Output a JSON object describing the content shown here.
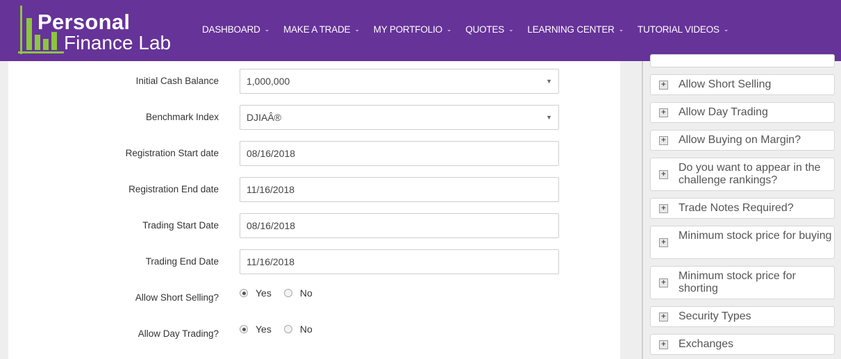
{
  "brand": {
    "line1": "Personal",
    "line2": "Finance Lab"
  },
  "nav": [
    {
      "label": "DASHBOARD"
    },
    {
      "label": "MAKE A TRADE"
    },
    {
      "label": "MY PORTFOLIO"
    },
    {
      "label": "QUOTES"
    },
    {
      "label": "LEARNING CENTER"
    },
    {
      "label": "TUTORIAL VIDEOS"
    }
  ],
  "form": {
    "initial_cash": {
      "label": "Initial Cash Balance",
      "value": "1,000,000"
    },
    "benchmark": {
      "label": "Benchmark Index",
      "value": "DJIAÂ®"
    },
    "reg_start": {
      "label": "Registration Start date",
      "value": "08/16/2018"
    },
    "reg_end": {
      "label": "Registration End date",
      "value": "11/16/2018"
    },
    "trade_start": {
      "label": "Trading Start Date",
      "value": "08/16/2018"
    },
    "trade_end": {
      "label": "Trading End Date",
      "value": "11/16/2018"
    },
    "short_selling": {
      "label": "Allow Short Selling?",
      "yes": "Yes",
      "no": "No",
      "selected": "Yes"
    },
    "day_trading": {
      "label": "Allow Day Trading?",
      "yes": "Yes",
      "no": "No",
      "selected": "Yes"
    }
  },
  "sidebar": {
    "items": [
      {
        "label": "Allow Short Selling"
      },
      {
        "label": "Allow Day Trading"
      },
      {
        "label": "Allow Buying on Margin?"
      },
      {
        "label": "Do you want to appear in the challenge rankings?"
      },
      {
        "label": "Trade Notes Required?"
      },
      {
        "label": "Minimum stock price for buying"
      },
      {
        "label": "Minimum stock price for shorting"
      },
      {
        "label": "Security Types"
      },
      {
        "label": "Exchanges"
      }
    ]
  },
  "colors": {
    "header": "#663399",
    "logo_green": "#8cc63f"
  }
}
